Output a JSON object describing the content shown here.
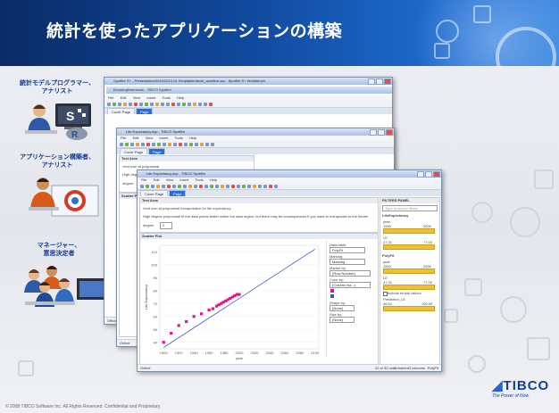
{
  "slide": {
    "title": "統計を使ったアプリケーションの構築",
    "footer": "© 2008 TIBCO Software Inc. All Rights Reserved. Confidential and Proprietary.",
    "brand": "TIBCO",
    "brand_tagline": "The Power of Now"
  },
  "roles": [
    {
      "label": "統計モデルプログラマー、\nアナリスト",
      "icon": "statistician-icon"
    },
    {
      "label": "アプリケーション構築者、\nアナリスト",
      "icon": "app-builder-icon"
    },
    {
      "label": "マネージャー、\n意思決定者",
      "icon": "manager-icon"
    }
  ],
  "windows": {
    "back": {
      "title": "Spotfire S+ - Presentation/2010/2010-01 Scriptable/devel_wowfine.ssc - Spotfire S+ Workbench",
      "inner_title": "Breakingfirstminute - TIBCO Spotfire",
      "menu": [
        "File",
        "Edit",
        "View",
        "Insert",
        "Tools",
        "Help"
      ],
      "tabs": [
        "Cover Page",
        "Page"
      ],
      "status": "Office"
    },
    "mid": {
      "title": "Life Expectancy.dxp - TIBCO Spotfire",
      "menu": [
        "File",
        "Edit",
        "View",
        "Insert",
        "Tools",
        "Help"
      ],
      "tabs": [
        "Cover Page",
        "Page"
      ],
      "text_area_title": "Text Area",
      "text1": "Vent icon at polynomial",
      "text2": "High degree polynomial",
      "degree_label": "degree",
      "degree_value": "2",
      "plot_title": "Scatter Plot",
      "status": "Online"
    },
    "front": {
      "title": "Life Expectancy.dxp - TIBCO Spotfire",
      "menu": [
        "File",
        "Edit",
        "View",
        "Insert",
        "Tools",
        "Help"
      ],
      "tabs": [
        "Cover Page",
        "Page"
      ],
      "text_area_title": "Text Area",
      "text1": "Vent icon at polynomial extrapolation for life expectancy.",
      "text2": "High degree polynomial fit the data points better within the data region, but there may be consequences if you want to extrapolate to the future!",
      "degree_label": "degree",
      "degree_value": "2",
      "plot_title": "Scatter Plot",
      "legend": {
        "data_label": "Data table:",
        "data_value": "PolyFit",
        "marking_label": "Marking:",
        "marking_value": "Marking",
        "marker_label": "Marker by:",
        "marker_value": "(Row Number)",
        "color_label": "Color by:",
        "color_value": "(Column Na...)",
        "shape_label": "Shape by:",
        "shape_value": "(None)",
        "size_label": "Size by:",
        "size_value": "(None)"
      },
      "filters": {
        "title": "FILTERS PANEL",
        "search_placeholder": "Type to search filters",
        "groups": [
          "LifeExpectancy",
          "PolyFit"
        ],
        "items": [
          "year",
          "LE",
          "year",
          "LE",
          "Prediction_LE"
        ],
        "year_min": "1900",
        "year_max": "2000",
        "le_min": "47.31",
        "le_max": "77.00",
        "checkbox": "Include empty values",
        "pred_min": "46.61",
        "pred_max": "100.00"
      },
      "x_axis_label": "year",
      "y_axis_label": "Life Expectancy",
      "status": "Online",
      "status_right": [
        "32 of 32 rows",
        "0 marked",
        "3 columns",
        "PolyFit"
      ]
    }
  },
  "chart_data": {
    "type": "scatter",
    "x_ticks": [
      "1900",
      "1920",
      "1940",
      "1960",
      "1980",
      "2000",
      "2020",
      "2040",
      "2060",
      "2080",
      "2100"
    ],
    "y_ticks": [
      "40",
      "50",
      "60",
      "70",
      "80",
      "90",
      "100",
      "110"
    ],
    "xlim": [
      1895,
      2105
    ],
    "ylim": [
      35,
      115
    ],
    "points": [
      {
        "x": 1900,
        "y": 40
      },
      {
        "x": 1910,
        "y": 47
      },
      {
        "x": 1920,
        "y": 53
      },
      {
        "x": 1930,
        "y": 56
      },
      {
        "x": 1940,
        "y": 60
      },
      {
        "x": 1950,
        "y": 62
      },
      {
        "x": 1960,
        "y": 65
      },
      {
        "x": 1965,
        "y": 66
      },
      {
        "x": 1970,
        "y": 68
      },
      {
        "x": 1973,
        "y": 69
      },
      {
        "x": 1976,
        "y": 70
      },
      {
        "x": 1979,
        "y": 71
      },
      {
        "x": 1982,
        "y": 72
      },
      {
        "x": 1985,
        "y": 73
      },
      {
        "x": 1988,
        "y": 74
      },
      {
        "x": 1991,
        "y": 75
      },
      {
        "x": 1994,
        "y": 76
      },
      {
        "x": 1997,
        "y": 77
      },
      {
        "x": 2000,
        "y": 77
      }
    ],
    "fit_line": [
      [
        1900,
        36
      ],
      [
        2100,
        112
      ]
    ],
    "point_color": "#e0148c",
    "line_color": "#3a57c8"
  }
}
